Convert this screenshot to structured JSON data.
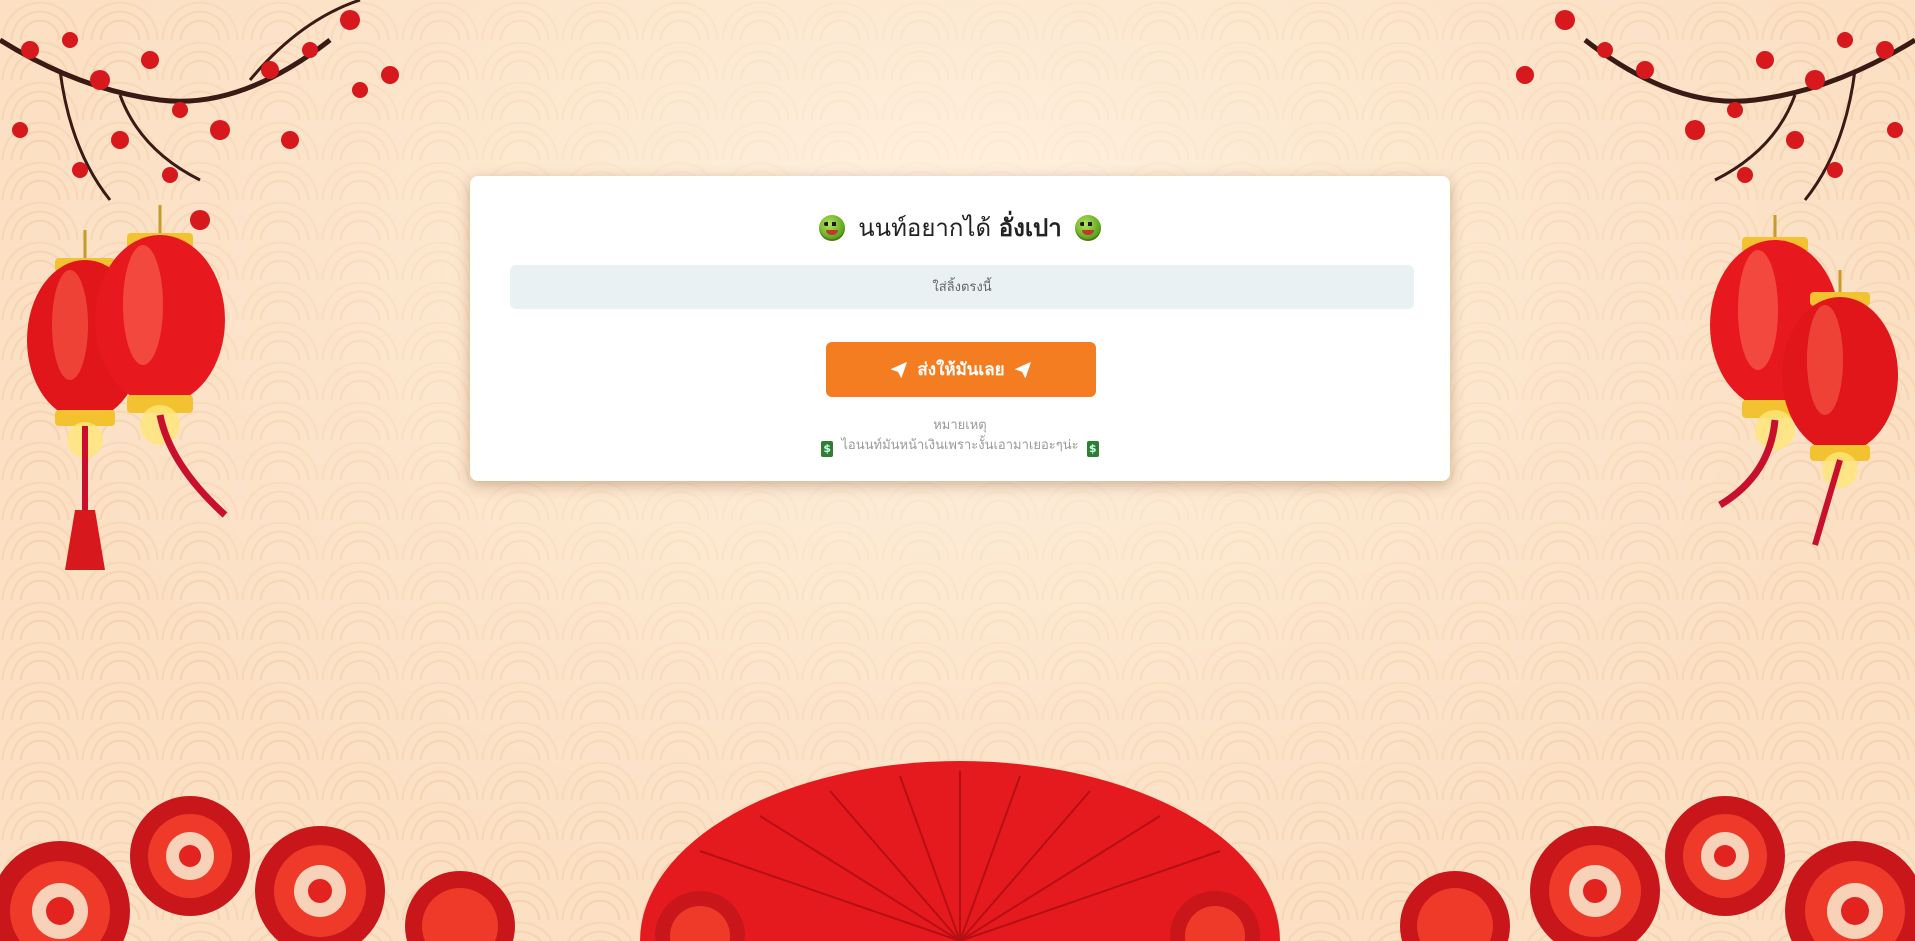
{
  "card": {
    "title_prefix": "นนท์อยากได้",
    "title_strong": "อั่งเปา",
    "title_emoji": "money-mouth-face-icon"
  },
  "form": {
    "link_placeholder": "ใส่ลิ้งตรงนี้",
    "link_value": "",
    "submit_label": "ส่งให้มันเลย",
    "submit_icon": "paper-plane-icon"
  },
  "note": {
    "title": "หมายเหตุ",
    "text": "ไอนนท์มันหน้าเงินเพราะงั้นเอามาเยอะๆน่ะ",
    "icon": "dollar-icon"
  },
  "colors": {
    "accent": "#f47d22",
    "input_bg": "#e9f1f3",
    "lantern_red": "#e0161b",
    "lantern_gold": "#f2c230"
  }
}
